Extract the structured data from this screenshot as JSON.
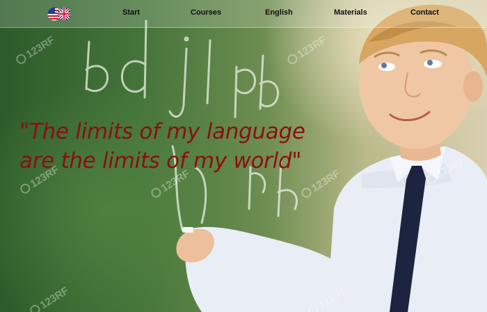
{
  "nav": {
    "items": [
      {
        "label": "Start"
      },
      {
        "label": "Courses"
      },
      {
        "label": "English"
      },
      {
        "label": "Materials"
      },
      {
        "label": "Contact"
      }
    ],
    "flag_icon": "us-uk-flag-icon"
  },
  "hero": {
    "quote_line1": "\"The limits of my language",
    "quote_line2": "are the limits of my world\""
  },
  "colors": {
    "quote": "#8a1010",
    "nav_text": "#111111"
  }
}
